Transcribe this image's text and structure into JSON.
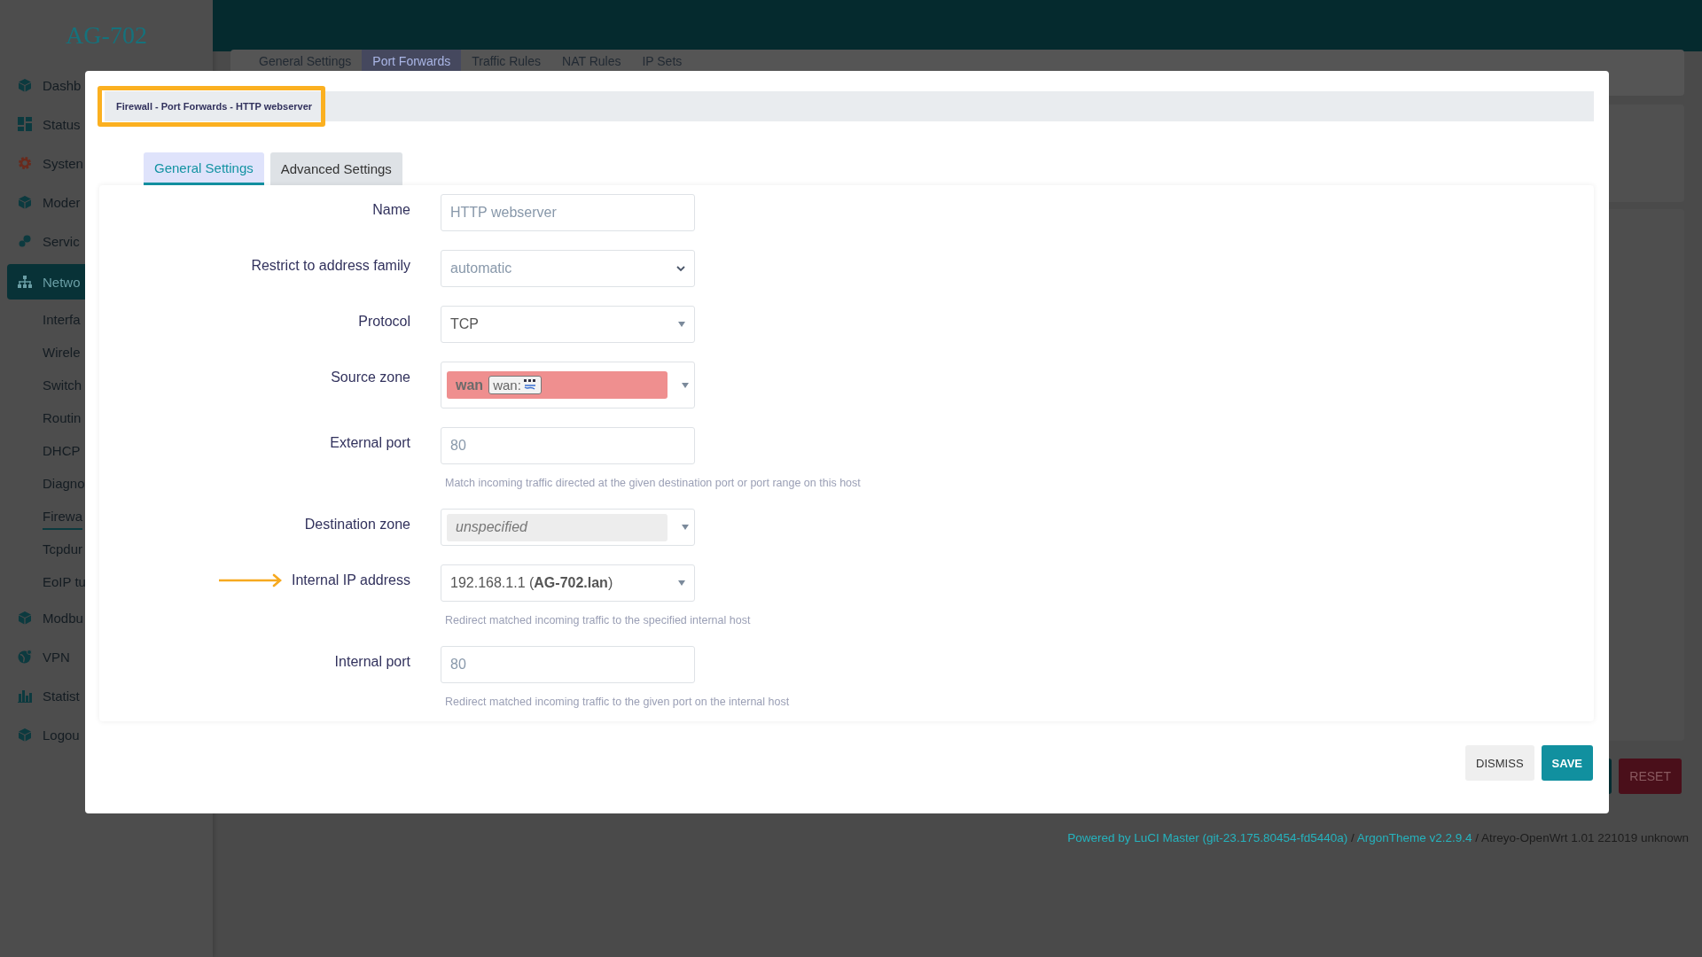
{
  "sidebar": {
    "logo": "AG-702",
    "items": [
      {
        "label": "Dashb",
        "selected": false
      },
      {
        "label": "Status",
        "selected": false
      },
      {
        "label": "Systen",
        "selected": false
      },
      {
        "label": "Moder",
        "selected": false
      },
      {
        "label": "Servic",
        "selected": false
      },
      {
        "label": "Netwo",
        "selected": true,
        "children": [
          {
            "label": "Interfa",
            "selected": false
          },
          {
            "label": "Wirele",
            "selected": false
          },
          {
            "label": "Switch",
            "selected": false
          },
          {
            "label": "Routin",
            "selected": false
          },
          {
            "label": "DHCP",
            "selected": false
          },
          {
            "label": "Diagno",
            "selected": false
          },
          {
            "label": "Firewa",
            "selected": true
          },
          {
            "label": "Tcpdur",
            "selected": false
          },
          {
            "label": "EoIP tu",
            "selected": false
          }
        ]
      },
      {
        "label": "Modbu",
        "selected": false
      },
      {
        "label": "VPN",
        "selected": false
      },
      {
        "label": "Statist",
        "selected": false
      },
      {
        "label": "Logou",
        "selected": false
      }
    ]
  },
  "page": {
    "tabs": [
      {
        "label": "General Settings",
        "selected": false
      },
      {
        "label": "Port Forwards",
        "selected": true
      },
      {
        "label": "Traffic Rules",
        "selected": false
      },
      {
        "label": "NAT Rules",
        "selected": false
      },
      {
        "label": "IP Sets",
        "selected": false
      }
    ],
    "actions": [
      {
        "kind": "apply"
      },
      {
        "kind": "reset",
        "label": "RESET"
      }
    ],
    "footer": [
      {
        "kind": "link",
        "text": "Powered by LuCI Master (git-23.175.80454-fd5440a)"
      },
      {
        "kind": "text",
        "text": " / "
      },
      {
        "kind": "link",
        "text": "ArgonTheme v2.2.9.4"
      },
      {
        "kind": "text",
        "text": " / Atreyo-OpenWrt 1.01 221019 unknown"
      }
    ]
  },
  "modal": {
    "breadcrumb": "Firewall - Port Forwards - HTTP webserver",
    "breadcrumb_highlighted": true,
    "tabs": [
      {
        "label": "General Settings",
        "selected": true
      },
      {
        "label": "Advanced Settings",
        "selected": false
      }
    ],
    "fields": [
      {
        "kind": "text",
        "label": "Name",
        "value": "HTTP webserver",
        "pointed": false
      },
      {
        "kind": "select",
        "label": "Restrict to address family",
        "value": "automatic",
        "pointed": false
      },
      {
        "kind": "dropdown",
        "label": "Protocol",
        "value": "TCP",
        "pointed": false
      },
      {
        "kind": "zone",
        "label": "Source zone",
        "value": "wan",
        "chip": "wan:",
        "pointed": false
      },
      {
        "kind": "text",
        "label": "External port",
        "value": "80",
        "help": "Match incoming traffic directed at the given destination port or port range on this host",
        "pointed": false
      },
      {
        "kind": "zone-empty",
        "label": "Destination zone",
        "value": "unspecified",
        "pointed": false
      },
      {
        "kind": "dropdown",
        "label": "Internal IP address",
        "value": "192.168.1.1 (**AG-702.lan**)",
        "help": "Redirect matched incoming traffic to the specified internal host",
        "pointed": true
      },
      {
        "kind": "text",
        "label": "Internal port",
        "value": "80",
        "help": "Redirect matched incoming traffic to the given port on the internal host",
        "pointed": false
      }
    ],
    "buttons": [
      {
        "kind": "default",
        "label": "DISMISS"
      },
      {
        "kind": "primary",
        "label": "SAVE"
      }
    ]
  }
}
